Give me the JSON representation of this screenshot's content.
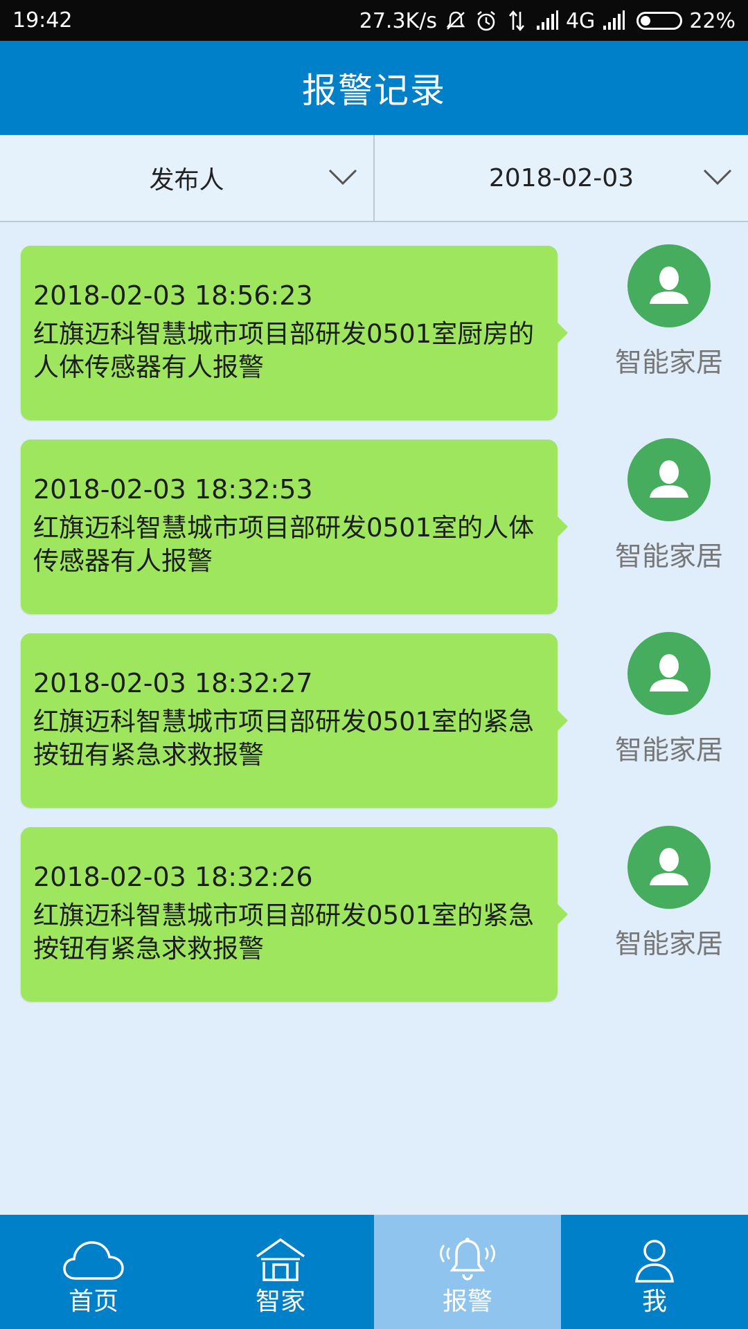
{
  "status_bar": {
    "time": "19:42",
    "net_speed": "27.3K/s",
    "network": "4G",
    "battery": "22%"
  },
  "header": {
    "title": "报警记录"
  },
  "filters": [
    {
      "label": "发布人"
    },
    {
      "label": "2018-02-03"
    }
  ],
  "alarms": [
    {
      "time": "2018-02-03 18:56:23",
      "message": "红旗迈科智慧城市项目部研发0501室厨房的人体传感器有人报警",
      "publisher": "智能家居"
    },
    {
      "time": "2018-02-03 18:32:53",
      "message": "红旗迈科智慧城市项目部研发0501室的人体传感器有人报警",
      "publisher": "智能家居"
    },
    {
      "time": "2018-02-03 18:32:27",
      "message": "红旗迈科智慧城市项目部研发0501室的紧急按钮有紧急求救报警",
      "publisher": "智能家居"
    },
    {
      "time": "2018-02-03 18:32:26",
      "message": "红旗迈科智慧城市项目部研发0501室的紧急按钮有紧急求救报警",
      "publisher": "智能家居"
    }
  ],
  "tabs": [
    {
      "label": "首页",
      "icon": "cloud-icon"
    },
    {
      "label": "智家",
      "icon": "house-icon"
    },
    {
      "label": "报警",
      "icon": "bell-icon"
    },
    {
      "label": "我",
      "icon": "person-icon"
    }
  ],
  "active_tab": 2,
  "colors": {
    "primary": "#0080c9",
    "bubble": "#9ee65e",
    "avatar": "#46ac5e",
    "active_tab": "#8ec4ee"
  }
}
